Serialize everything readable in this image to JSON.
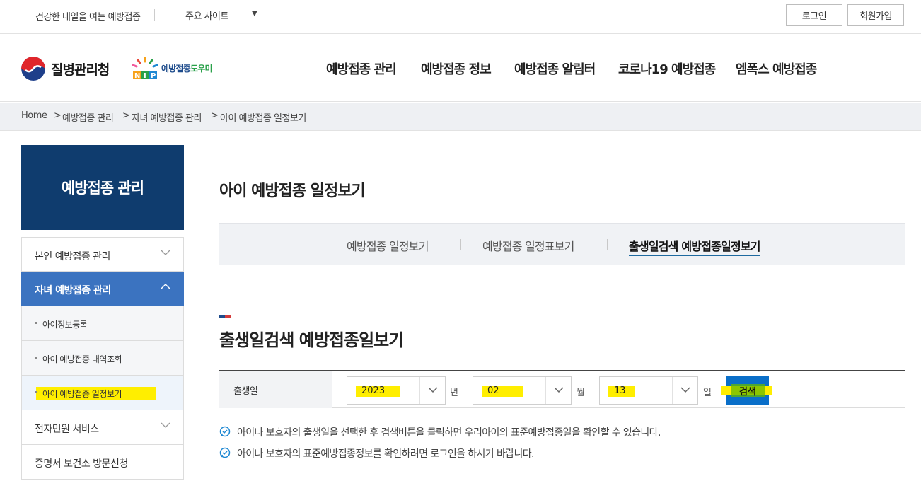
{
  "topbar": {
    "slogan": "건강한 내일을 여는 예방접종",
    "sites_label": "주요 사이트",
    "login": "로그인",
    "join": "회원가입"
  },
  "header": {
    "org_name": "질병관리청",
    "nip_name_a": "예방접종",
    "nip_name_b": "도우미",
    "nav": [
      "예방접종 관리",
      "예방접종 정보",
      "예방접종 알림터",
      "코로나19 예방접종",
      "엠폭스 예방접종"
    ]
  },
  "breadcrumb": [
    "Home",
    "예방접종 관리",
    "자녀 예방접종 관리",
    "아이 예방접종 일정보기"
  ],
  "sidebar": {
    "title": "예방접종 관리",
    "items": [
      {
        "label": "본인 예방접종 관리"
      },
      {
        "label": "자녀 예방접종 관리"
      },
      {
        "label": "아이정보등록"
      },
      {
        "label": "아이 예방접종 내역조회"
      },
      {
        "label": "아이 예방접종 일정보기"
      },
      {
        "label": "전자민원 서비스"
      },
      {
        "label": "증명서 보건소 방문신청"
      }
    ]
  },
  "main": {
    "page_title": "아이 예방접종 일정보기",
    "tabs": [
      "예방접종 일정보기",
      "예방접종 일정표보기",
      "출생일검색 예방접종일정보기"
    ],
    "section_title": "출생일검색 예방접종일보기",
    "form": {
      "label": "출생일",
      "year": "2023",
      "year_unit": "년",
      "month": "02",
      "month_unit": "월",
      "day": "13",
      "day_unit": "일",
      "search": "검색"
    },
    "notes": [
      "아이나 보호자의 출생일을 선택한 후 검색버튼을 클릭하면 우리아이의 표준예방접종일을 확인할 수 있습니다.",
      "아이나 보호자의 표준예방접종정보를 확인하려면 로그인을 하시기 바랍니다."
    ]
  },
  "colors": {
    "navy": "#0f3c6e",
    "active_blue": "#3b73c0",
    "button_blue": "#0a6fc9",
    "highlight": "#ffee00"
  }
}
